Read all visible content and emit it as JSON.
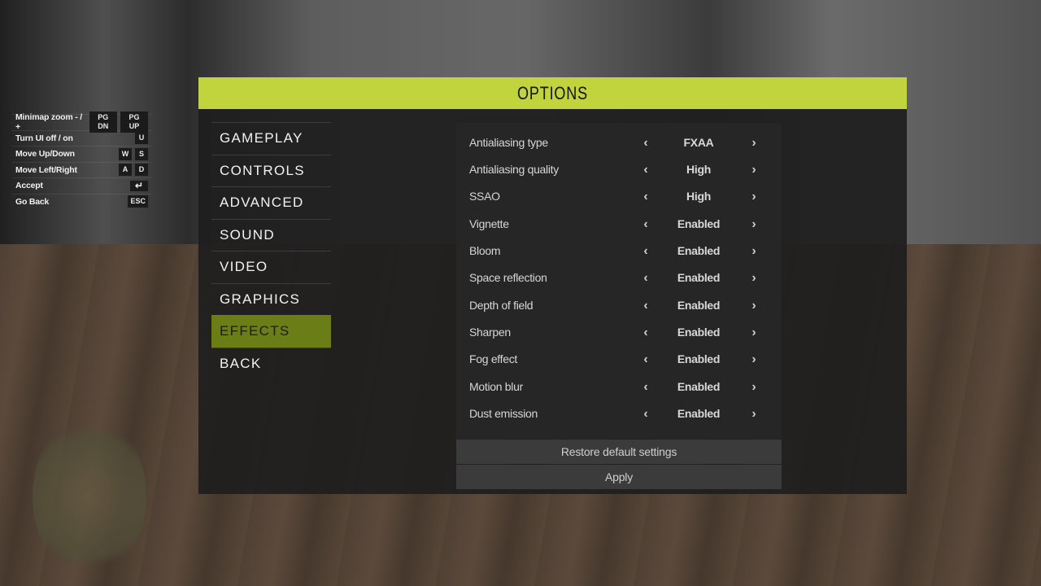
{
  "help": {
    "rows": [
      {
        "label": "Minimap zoom - / +",
        "keys": [
          "PG DN",
          "PG UP"
        ]
      },
      {
        "label": "Turn UI off / on",
        "keys": [
          "U"
        ]
      },
      {
        "label": "Move Up/Down",
        "keys": [
          "W",
          "S"
        ]
      },
      {
        "label": "Move Left/Right",
        "keys": [
          "A",
          "D"
        ]
      },
      {
        "label": "Accept",
        "keys": [
          "↵"
        ]
      },
      {
        "label": "Go Back",
        "keys": [
          "ESC"
        ]
      }
    ]
  },
  "window": {
    "title": "OPTIONS"
  },
  "menu": {
    "items": [
      {
        "label": "GAMEPLAY",
        "active": false
      },
      {
        "label": "CONTROLS",
        "active": false
      },
      {
        "label": "ADVANCED",
        "active": false
      },
      {
        "label": "SOUND",
        "active": false
      },
      {
        "label": "VIDEO",
        "active": false
      },
      {
        "label": "GRAPHICS",
        "active": false
      },
      {
        "label": "EFFECTS",
        "active": true
      },
      {
        "label": "BACK",
        "active": false
      }
    ]
  },
  "settings": [
    {
      "label": "Antialiasing type",
      "value": "FXAA"
    },
    {
      "label": "Antialiasing quality",
      "value": "High"
    },
    {
      "label": "SSAO",
      "value": "High"
    },
    {
      "label": "Vignette",
      "value": "Enabled"
    },
    {
      "label": "Bloom",
      "value": "Enabled"
    },
    {
      "label": "Space reflection",
      "value": "Enabled"
    },
    {
      "label": "Depth of field",
      "value": "Enabled"
    },
    {
      "label": "Sharpen",
      "value": "Enabled"
    },
    {
      "label": "Fog effect",
      "value": "Enabled"
    },
    {
      "label": "Motion blur",
      "value": "Enabled"
    },
    {
      "label": "Dust emission",
      "value": "Enabled"
    }
  ],
  "buttons": {
    "restore_label": "Restore default settings",
    "apply_label": "Apply"
  },
  "colors": {
    "accent": "#c2d43d",
    "active_menu": "#6b7d17"
  }
}
